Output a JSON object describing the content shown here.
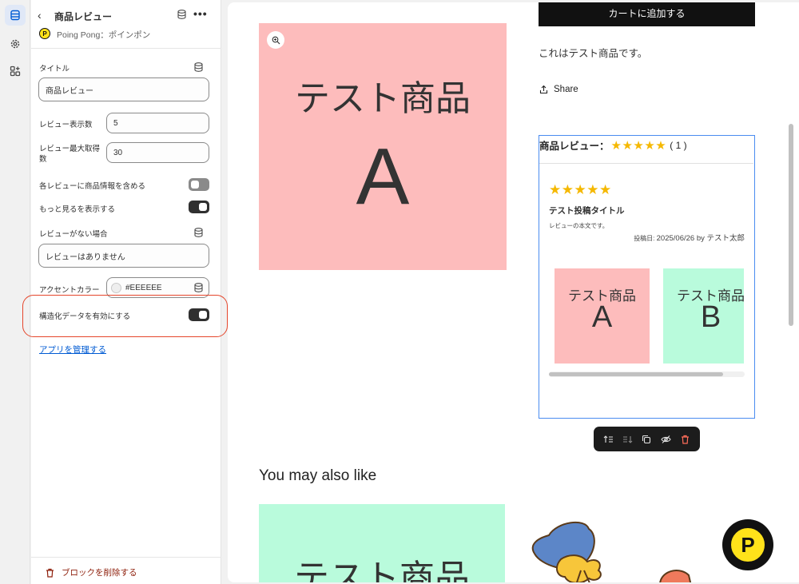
{
  "header": {
    "title": "商品レビュー",
    "app_name": "Poing Pong：ポインポン",
    "app_badge": "P"
  },
  "settings": {
    "title_label": "タイトル",
    "title_value": "商品レビュー",
    "review_count_label": "レビュー表示数",
    "review_count_value": "5",
    "review_max_label": "レビュー最大取得数",
    "review_max_value": "30",
    "include_product_label": "各レビューに商品情報を含める",
    "include_product_enabled": false,
    "show_more_label": "もっと見るを表示する",
    "show_more_enabled": true,
    "no_review_label": "レビューがない場合",
    "no_review_value": "レビューはありません",
    "accent_label": "アクセントカラー",
    "accent_value": "#EEEEEE",
    "structured_label": "構造化データを有効にする",
    "structured_enabled": true,
    "manage_link": "アプリを管理する",
    "delete_label": "ブロックを削除する"
  },
  "preview": {
    "product_image_line1": "テスト商品",
    "product_image_line2": "A",
    "product_image_color": "#fdbcbc",
    "cart_button": "カートに追加する",
    "description": "これはテスト商品です。",
    "share": "Share",
    "review_heading": "商品レビュー：",
    "review_heading_stars": "★★★★★",
    "review_count": "( 1 )",
    "review": {
      "stars": "★★★★★",
      "title": "テスト投稿タイトル",
      "body": "レビューの本文です。",
      "meta_prefix": "投稿日: ",
      "meta": "2025/06/26 by テスト太郎"
    },
    "cards": [
      {
        "line1": "テスト商品",
        "line2": "A",
        "color": "#fdbcbc"
      },
      {
        "line1": "テスト商品",
        "line2": "B",
        "color": "#b9fbdc"
      }
    ],
    "also_like": "You may also like",
    "also_card_text": "テスト商品",
    "logo_letter": "P"
  },
  "colors": {
    "accent_blue": "#005bd3",
    "highlight_red": "#e5462c",
    "star": "#f5b800"
  }
}
